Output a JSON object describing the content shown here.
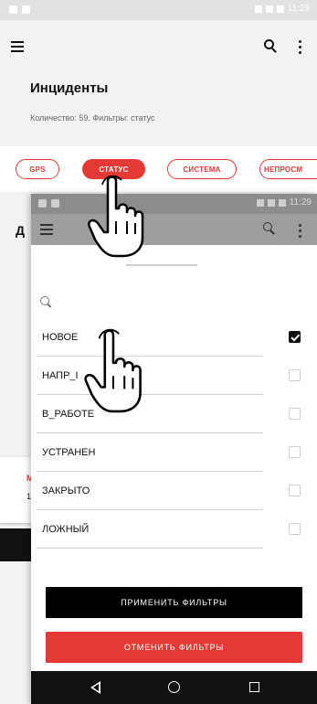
{
  "status_bar": {
    "time": "11:29"
  },
  "overlay_status_bar": {
    "time": "11:29"
  },
  "app_bar": {
    "menu_icon": "hamburger-icon",
    "search_icon": "search-icon",
    "more_icon": "kebab-icon"
  },
  "page": {
    "title": "Инциденты",
    "count_line": "Количество: 59.  Фильтры: статус"
  },
  "filter_chips": [
    {
      "label": "GPS",
      "active": false
    },
    {
      "label": "СТАТУС",
      "active": true
    },
    {
      "label": "СИСТЕМА",
      "active": false
    },
    {
      "label": "НЕПРОСМ",
      "active": false
    }
  ],
  "background_fragments": {
    "letter": "Д",
    "card_letter": "М",
    "card_number": "1"
  },
  "filter_panel": {
    "search_icon": "search-icon",
    "options": [
      {
        "label": "НОВОЕ",
        "checked": true
      },
      {
        "label": "НАПР_I",
        "checked": false
      },
      {
        "label": "В_РАБОТЕ",
        "checked": false
      },
      {
        "label": "УСТРАНЕН",
        "checked": false
      },
      {
        "label": "ЗАКРЫТО",
        "checked": false
      },
      {
        "label": "ЛОЖНЫЙ",
        "checked": false
      }
    ],
    "apply_label": "ПРИМЕНИТЬ ФИЛЬТРЫ",
    "cancel_label": "ОТМЕНИТЬ ФИЛЬТРЫ"
  },
  "nav_bar": {
    "back_icon": "back-triangle-icon",
    "home_icon": "home-circle-icon",
    "recents_icon": "recents-square-icon"
  },
  "colors": {
    "accent": "#e53935",
    "black": "#000000",
    "status_bar": "#e2e2e2"
  }
}
